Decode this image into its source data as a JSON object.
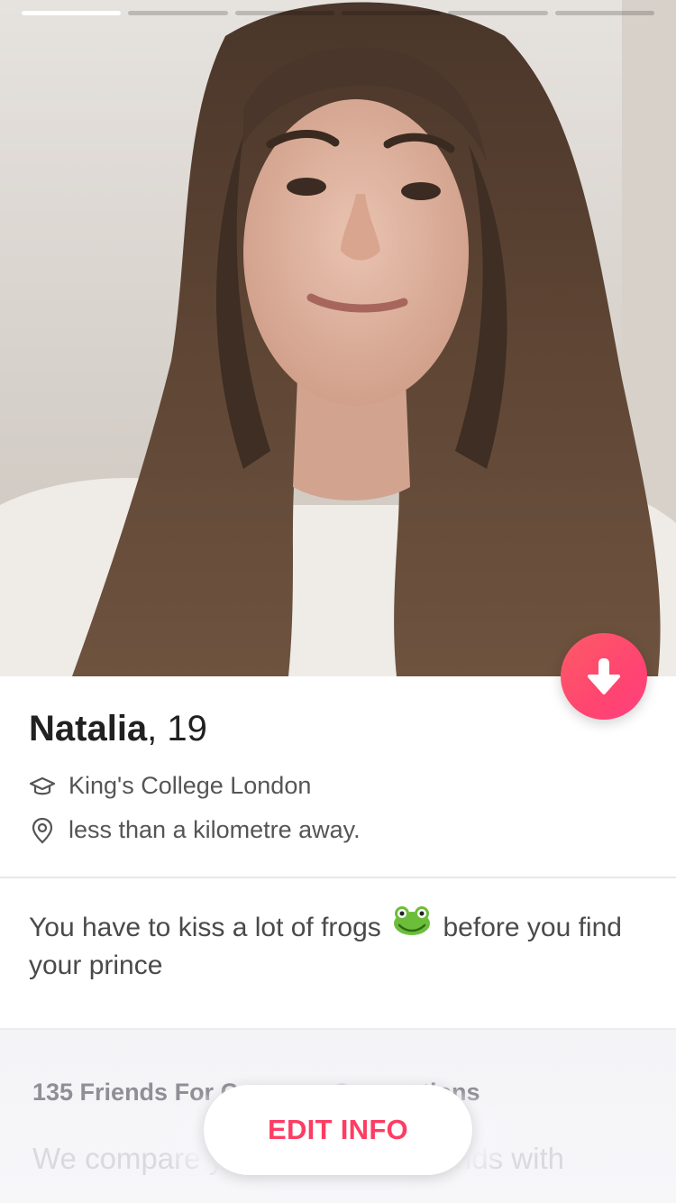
{
  "profile": {
    "name": "Natalia",
    "age": ", 19",
    "school": "King's College London",
    "distance": "less than a kilometre away.",
    "photo_count": 6,
    "current_photo": 1
  },
  "bio": {
    "text_before": "You have to kiss a lot of frogs",
    "emoji": "frog-emoji",
    "text_after": "before you find your prince"
  },
  "friends": {
    "title": "135 Friends For Common Connections",
    "description": "We compare your Facebook friends with"
  },
  "actions": {
    "edit_label": "EDIT INFO",
    "collapse_icon": "arrow-down-icon"
  },
  "colors": {
    "accent": "#fd3d63",
    "gradient_start": "#fd5b67",
    "gradient_end": "#ff3f7f"
  }
}
